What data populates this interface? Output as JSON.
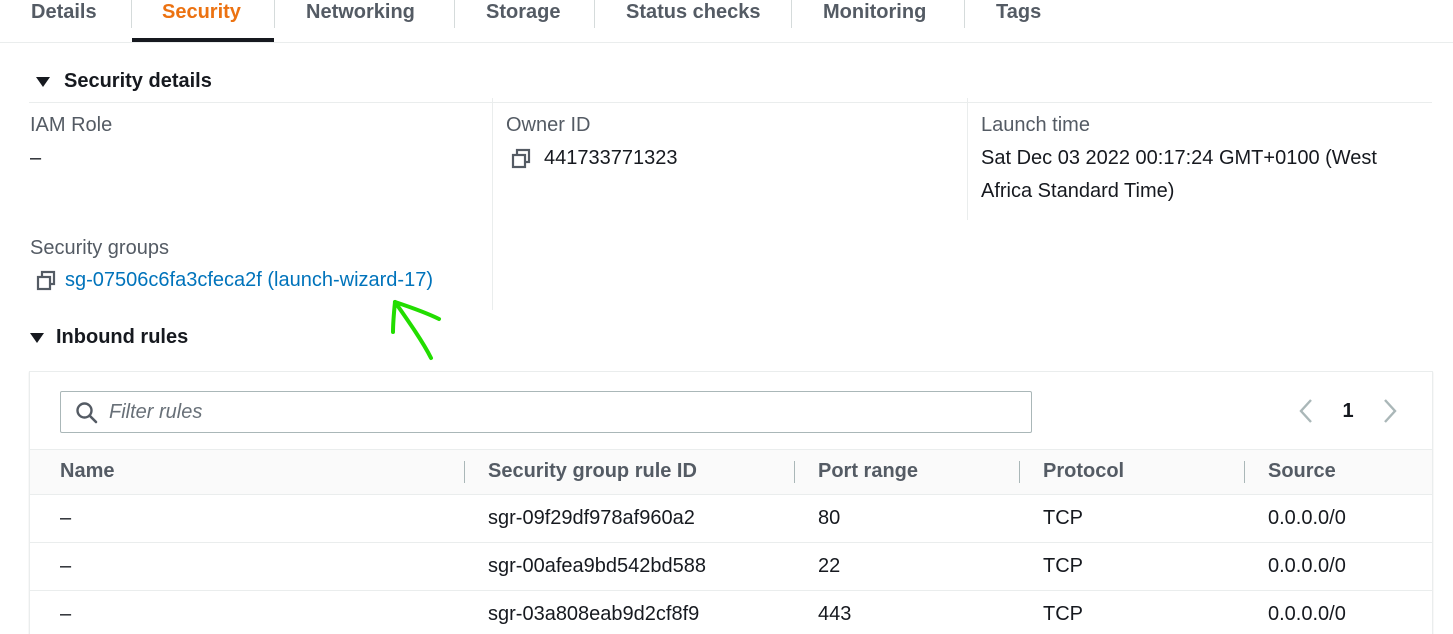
{
  "tabs": [
    {
      "label": "Details"
    },
    {
      "label": "Security"
    },
    {
      "label": "Networking"
    },
    {
      "label": "Storage"
    },
    {
      "label": "Status checks"
    },
    {
      "label": "Monitoring"
    },
    {
      "label": "Tags"
    }
  ],
  "active_tab": "Security",
  "security_details": {
    "title": "Security details",
    "iam_role": {
      "label": "IAM Role",
      "value": "–"
    },
    "owner_id": {
      "label": "Owner ID",
      "value": "441733771323"
    },
    "launch_time": {
      "label": "Launch time",
      "value_line1": "Sat Dec 03 2022 00:17:24 GMT+0100 (West",
      "value_line2": "Africa Standard Time)"
    },
    "security_groups": {
      "label": "Security groups",
      "value": "sg-07506c6fa3cfeca2f (launch-wizard-17)"
    }
  },
  "inbound_rules": {
    "title": "Inbound rules",
    "filter_placeholder": "Filter rules",
    "current_page": "1",
    "columns": [
      "Name",
      "Security group rule ID",
      "Port range",
      "Protocol",
      "Source"
    ],
    "rows": [
      {
        "name": "–",
        "rule_id": "sgr-09f29df978af960a2",
        "port_range": "80",
        "protocol": "TCP",
        "source": "0.0.0.0/0"
      },
      {
        "name": "–",
        "rule_id": "sgr-00afea9bd542bd588",
        "port_range": "22",
        "protocol": "TCP",
        "source": "0.0.0.0/0"
      },
      {
        "name": "–",
        "rule_id": "sgr-03a808eab9d2cf8f9",
        "port_range": "443",
        "protocol": "TCP",
        "source": "0.0.0.0/0"
      }
    ]
  },
  "colors": {
    "active_tab": "#ec7211",
    "link": "#0073bb",
    "annotation": "#22dd00"
  }
}
